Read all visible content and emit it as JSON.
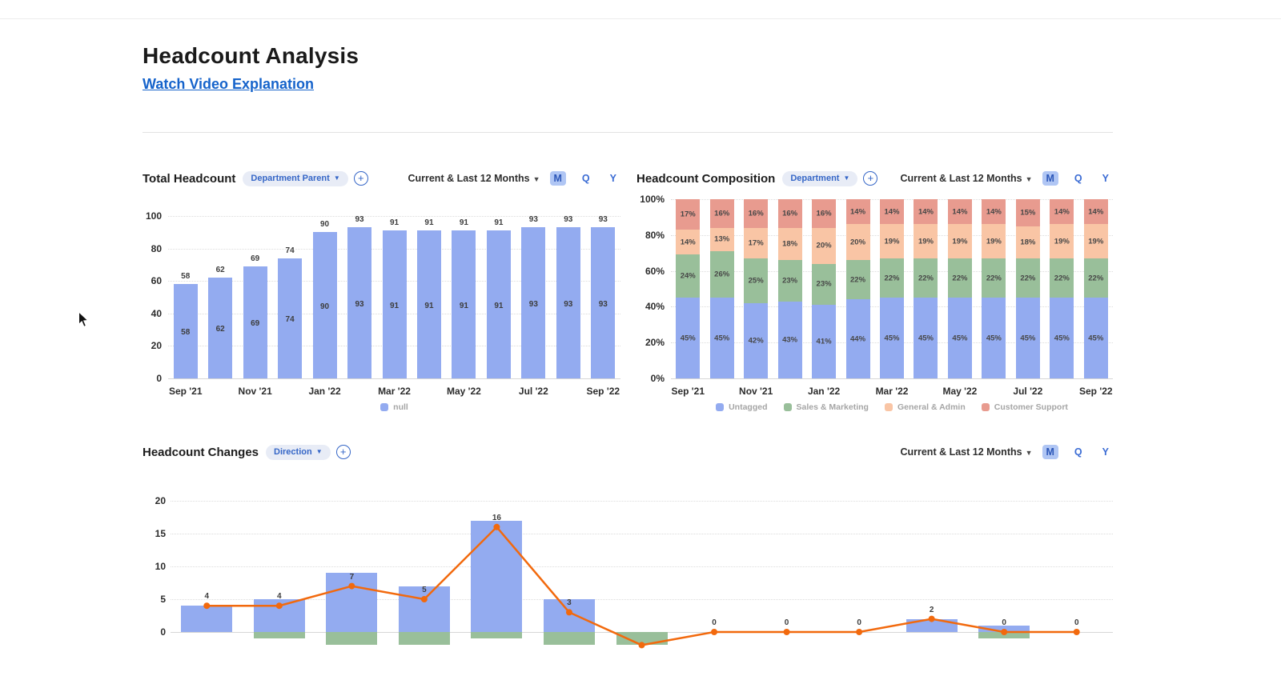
{
  "page": {
    "title": "Headcount Analysis",
    "video_link_label": "Watch Video Explanation"
  },
  "controls": {
    "time_range": "Current & Last 12 Months",
    "granularity": [
      "M",
      "Q",
      "Y"
    ],
    "selected_granularity": "M"
  },
  "panels": [
    {
      "title": "Total Headcount",
      "pill_label": "Department Parent"
    },
    {
      "title": "Headcount Composition",
      "pill_label": "Department"
    },
    {
      "title": "Headcount Changes",
      "pill_label": "Direction"
    }
  ],
  "colors": {
    "blue_bar": "#93abf0",
    "green_bar": "#99bf9a",
    "peach_bar": "#f9c5a5",
    "salmon_bar": "#e89b8f",
    "orange_line": "#f2690d",
    "link_blue": "#1563cb",
    "control_blue": "#3b6cd4",
    "selected_granularity_bg": "#b0c6f4"
  },
  "chart_data": [
    {
      "type": "bar",
      "title": "Total Headcount",
      "series_name": "null",
      "n_bars": 13,
      "values": [
        58,
        62,
        69,
        74,
        90,
        93,
        91,
        91,
        91,
        91,
        93,
        93,
        93
      ],
      "x_tick_labels": [
        "Sep '21",
        "Nov '21",
        "Jan '22",
        "Mar '22",
        "May '22",
        "Jul '22",
        "Sep '22"
      ],
      "tick_slots": [
        0,
        2,
        4,
        6,
        8,
        10,
        12
      ],
      "ylim": [
        0,
        100
      ],
      "yticks": [
        0,
        20,
        40,
        60,
        80,
        100
      ],
      "grid": true,
      "legend_position": "bottom"
    },
    {
      "type": "bar-stacked-100",
      "title": "Headcount Composition",
      "n_bars": 13,
      "series": [
        {
          "name": "Untagged",
          "color": "#93abf0",
          "values": [
            45,
            45,
            42,
            43,
            41,
            44,
            45,
            45,
            45,
            45,
            45,
            45,
            45
          ]
        },
        {
          "name": "Sales & Marketing",
          "color": "#99bf9a",
          "values": [
            24,
            26,
            25,
            23,
            23,
            22,
            22,
            22,
            22,
            22,
            22,
            22,
            22
          ]
        },
        {
          "name": "General & Admin",
          "color": "#f9c5a5",
          "values": [
            14,
            13,
            17,
            18,
            20,
            20,
            19,
            19,
            19,
            19,
            18,
            19,
            19
          ]
        },
        {
          "name": "Customer Support",
          "color": "#e89b8f",
          "values": [
            17,
            16,
            16,
            16,
            16,
            14,
            14,
            14,
            14,
            14,
            15,
            14,
            14
          ]
        }
      ],
      "x_tick_labels": [
        "Sep '21",
        "Nov '21",
        "Jan '22",
        "Mar '22",
        "May '22",
        "Jul '22",
        "Sep '22"
      ],
      "tick_slots": [
        0,
        2,
        4,
        6,
        8,
        10,
        12
      ],
      "ylim": [
        0,
        100
      ],
      "ytick_labels": [
        "0%",
        "20%",
        "40%",
        "60%",
        "80%",
        "100%"
      ],
      "grid": true,
      "legend_position": "bottom"
    },
    {
      "type": "combo",
      "title": "Headcount Changes",
      "n_bars": 13,
      "series": [
        {
          "name": "positive-changes",
          "type": "bar",
          "color": "#93abf0",
          "values": [
            4,
            5,
            9,
            7,
            17,
            5,
            0,
            0,
            0,
            0,
            2,
            1,
            0
          ]
        },
        {
          "name": "negative-changes",
          "type": "bar",
          "color": "#99bf9a",
          "values": [
            0,
            -1,
            -2,
            -2,
            -1,
            -2,
            -2,
            0,
            0,
            0,
            0,
            -1,
            0
          ]
        },
        {
          "name": "net-change-line",
          "type": "line",
          "color": "#f2690d",
          "values": [
            4,
            4,
            7,
            5,
            16,
            3,
            -2,
            0,
            0,
            0,
            2,
            0,
            0
          ]
        }
      ],
      "point_labels": [
        "4",
        "4",
        "7",
        "5",
        "16",
        "3",
        "",
        "0",
        "0",
        "0",
        "2",
        "0",
        "0"
      ],
      "yticks": [
        0,
        5,
        10,
        15,
        20
      ],
      "grid": true
    }
  ]
}
